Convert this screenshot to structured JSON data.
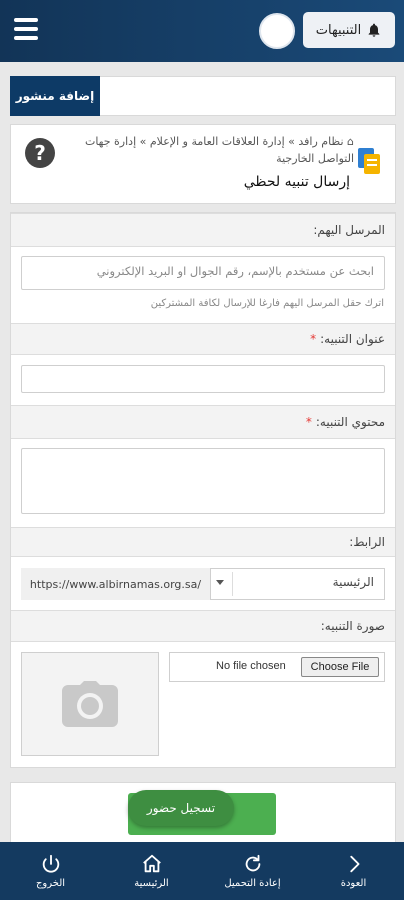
{
  "header": {
    "notifications_label": "التنبيهات"
  },
  "toolbar": {
    "add_post_label": "إضافة منشور"
  },
  "breadcrumb": {
    "home_icon": "home-icon",
    "items": [
      "نظام رافد",
      "إدارة العلاقات العامة و الإعلام",
      "إدارة جهات التواصل الخارجية"
    ],
    "sep": "»"
  },
  "page": {
    "title": "إرسال تنبيه لحظي",
    "help_icon": "?"
  },
  "form": {
    "recipients_label": "المرسل اليهم:",
    "recipients_placeholder": "ابحث عن مستخدم بالإسم، رقم الجوال او البريد الإلكتروني",
    "recipients_hint": "اترك حقل المرسل اليهم فارغا للإرسال لكافة المشتركين",
    "title_label": "عنوان التنبيه:",
    "title_value": "",
    "content_label": "محتوي التنبيه:",
    "content_value": "",
    "required_mark": "*",
    "link_label": "الرابط:",
    "link_selected": "الرئيسية",
    "link_url": "https://www.albirnamas.org.sa/",
    "image_label": "صورة التنبيه:",
    "file_status": "No file chosen",
    "choose_file": "Choose File"
  },
  "attendance": {
    "label": "تسجيل حضور"
  },
  "bottom_nav": {
    "items": [
      {
        "label": "الخروج",
        "icon": "power-icon"
      },
      {
        "label": "الرئيسية",
        "icon": "home-icon"
      },
      {
        "label": "إعادة التحميل",
        "icon": "reload-icon"
      },
      {
        "label": "العودة",
        "icon": "chevron-right-icon"
      }
    ]
  },
  "colors": {
    "header_bg": "#123457",
    "primary": "#0d3a66",
    "green": "#4caf50",
    "required": "#e53935"
  }
}
